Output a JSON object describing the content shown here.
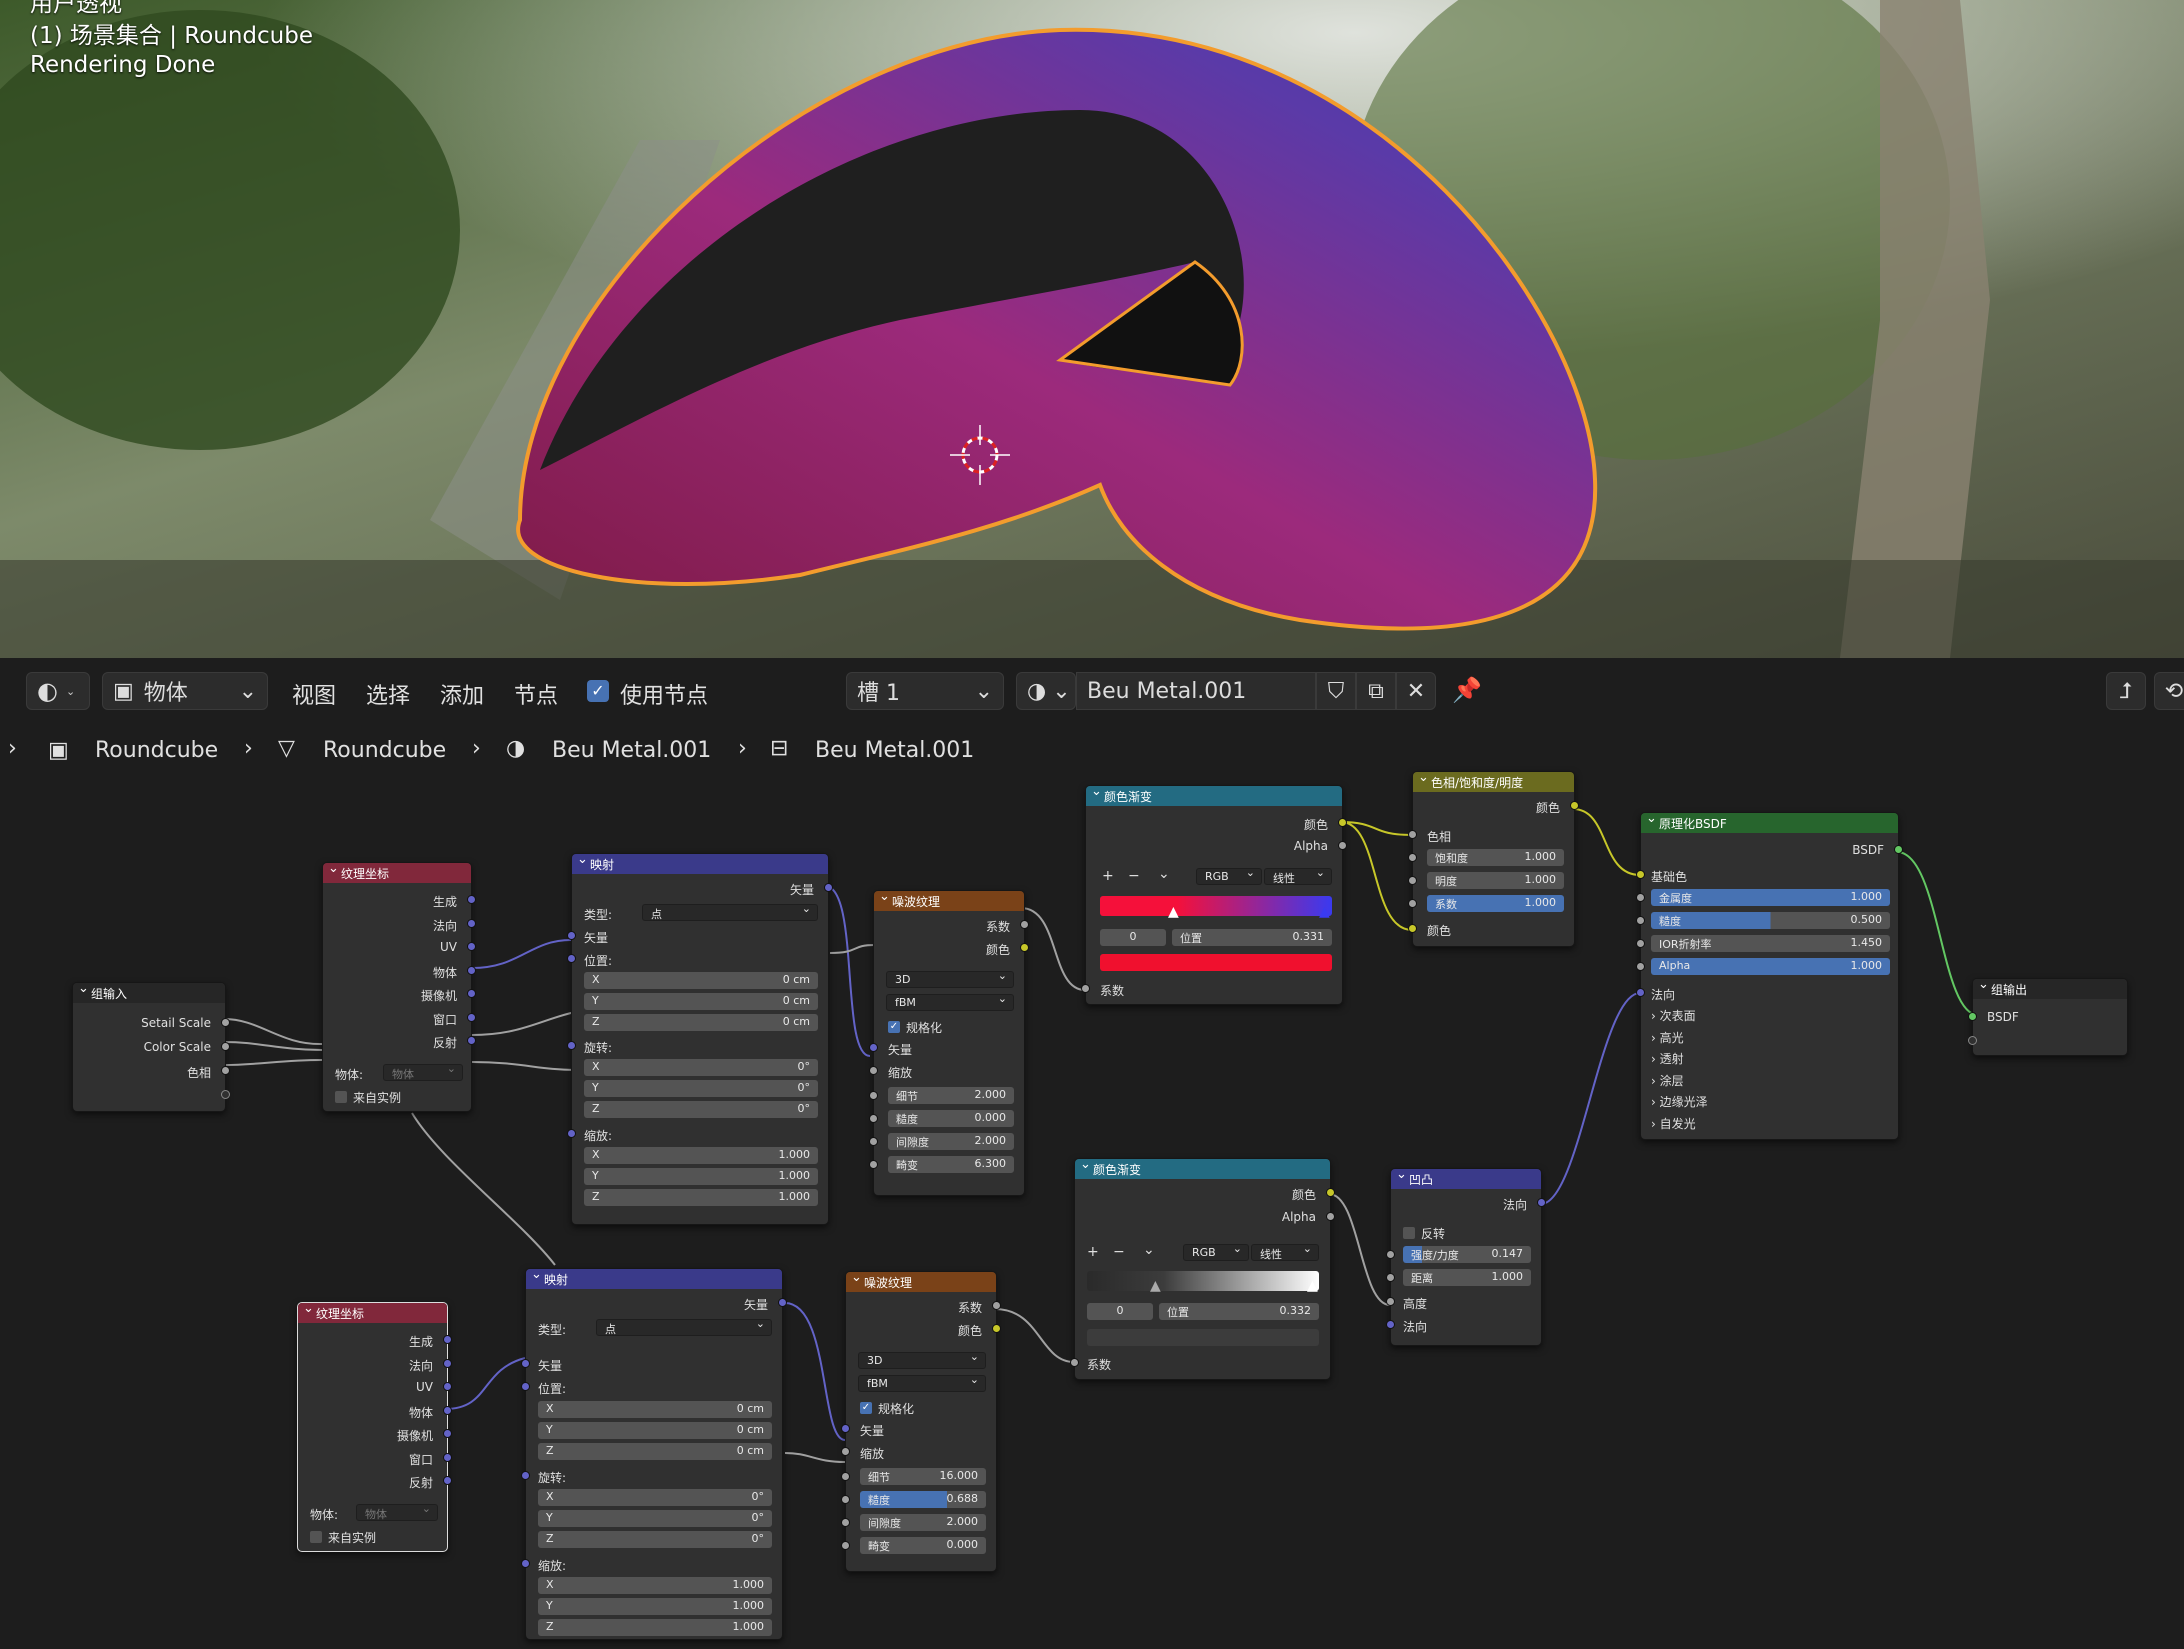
{
  "viewport": {
    "line0": "用户透视",
    "line1": "(1) 场景集合 | Roundcube",
    "line2": "Rendering Done",
    "object_outline_color": "#f39c2d"
  },
  "header": {
    "object_mode": "物体",
    "menus": [
      "视图",
      "选择",
      "添加",
      "节点"
    ],
    "use_nodes_label": "使用节点",
    "use_nodes_checked": true,
    "slot": "槽 1",
    "material_name": "Beu Metal.001"
  },
  "breadcrumb": [
    "Roundcube",
    "Roundcube",
    "Beu Metal.001",
    "Beu Metal.001"
  ],
  "nodes": {
    "group_input": {
      "title": "组输入",
      "outputs": [
        "Setail Scale",
        "Color Scale",
        "色相"
      ]
    },
    "texcoord1": {
      "title": "纹理坐标",
      "outputs": [
        "生成",
        "法向",
        "UV",
        "物体",
        "摄像机",
        "窗口",
        "反射"
      ],
      "object_label": "物体:",
      "object_placeholder": "物体",
      "instancer": "来自实例"
    },
    "mapping1": {
      "title": "映射",
      "out": "矢量",
      "type_label": "类型:",
      "type_value": "点",
      "vector": "矢量",
      "location": "位置:",
      "rotation": "旋转:",
      "scale": "缩放:",
      "loc": [
        [
          "X",
          "0 cm"
        ],
        [
          "Y",
          "0 cm"
        ],
        [
          "Z",
          "0 cm"
        ]
      ],
      "rot": [
        [
          "X",
          "0°"
        ],
        [
          "Y",
          "0°"
        ],
        [
          "Z",
          "0°"
        ]
      ],
      "scl": [
        [
          "X",
          "1.000"
        ],
        [
          "Y",
          "1.000"
        ],
        [
          "Z",
          "1.000"
        ]
      ]
    },
    "noise1": {
      "title": "噪波纹理",
      "out_fac": "系数",
      "out_color": "颜色",
      "dim": "3D",
      "type": "fBM",
      "normalize": "规格化",
      "vector": "矢量",
      "scale": "缩放",
      "detail": [
        "细节",
        "2.000"
      ],
      "roughness": [
        "糙度",
        "0.000"
      ],
      "lacunarity": [
        "间隙度",
        "2.000"
      ],
      "distortion": [
        "畸变",
        "6.300"
      ]
    },
    "ramp1": {
      "title": "颜色渐变",
      "out_color": "颜色",
      "out_alpha": "Alpha",
      "mode": "RGB",
      "interp": "线性",
      "index": "0",
      "pos_label": "位置",
      "pos_value": "0.331",
      "fac": "系数",
      "stop_color": "#f0102e",
      "ramp_start": "#f5103a",
      "ramp_end": "#3a3af0"
    },
    "hsv": {
      "title": "色相/饱和度/明度",
      "out": "颜色",
      "hue": "色相",
      "sat": [
        "饱和度",
        "1.000"
      ],
      "val": [
        "明度",
        "1.000"
      ],
      "fac": [
        "系数",
        "1.000"
      ],
      "color": "颜色"
    },
    "bsdf": {
      "title": "原理化BSDF",
      "out": "BSDF",
      "base": "基础色",
      "metallic": [
        "金属度",
        "1.000"
      ],
      "roughness": [
        "糙度",
        "0.500"
      ],
      "ior": [
        "IOR折射率",
        "1.450"
      ],
      "alpha": [
        "Alpha",
        "1.000"
      ],
      "normal": "法向",
      "panels": [
        "次表面",
        "高光",
        "透射",
        "涂层",
        "边缘光泽",
        "自发光"
      ]
    },
    "group_output": {
      "title": "组输出",
      "in": "BSDF"
    },
    "texcoord2": {
      "title": "纹理坐标",
      "outputs": [
        "生成",
        "法向",
        "UV",
        "物体",
        "摄像机",
        "窗口",
        "反射"
      ],
      "object_label": "物体:",
      "object_placeholder": "物体",
      "instancer": "来自实例"
    },
    "mapping2": {
      "title": "映射",
      "out": "矢量",
      "type_label": "类型:",
      "type_value": "点",
      "vector": "矢量",
      "location": "位置:",
      "rotation": "旋转:",
      "scale": "缩放:",
      "loc": [
        [
          "X",
          "0 cm"
        ],
        [
          "Y",
          "0 cm"
        ],
        [
          "Z",
          "0 cm"
        ]
      ],
      "rot": [
        [
          "X",
          "0°"
        ],
        [
          "Y",
          "0°"
        ],
        [
          "Z",
          "0°"
        ]
      ],
      "scl": [
        [
          "X",
          "1.000"
        ],
        [
          "Y",
          "1.000"
        ],
        [
          "Z",
          "1.000"
        ]
      ]
    },
    "noise2": {
      "title": "噪波纹理",
      "out_fac": "系数",
      "out_color": "颜色",
      "dim": "3D",
      "type": "fBM",
      "normalize": "规格化",
      "vector": "矢量",
      "scale": "缩放",
      "detail": [
        "细节",
        "16.000"
      ],
      "roughness": [
        "糙度",
        "0.688"
      ],
      "lacunarity": [
        "间隙度",
        "2.000"
      ],
      "distortion": [
        "畸变",
        "0.000"
      ]
    },
    "ramp2": {
      "title": "颜色渐变",
      "out_color": "颜色",
      "out_alpha": "Alpha",
      "mode": "RGB",
      "interp": "线性",
      "index": "0",
      "pos_label": "位置",
      "pos_value": "0.332",
      "fac": "系数",
      "stop_color": "#3c3c3c",
      "ramp_start": "#2a2a2a",
      "ramp_end": "#ffffff"
    },
    "bump": {
      "title": "凹凸",
      "out": "法向",
      "invert": "反转",
      "strength": [
        "强度/力度",
        "0.147"
      ],
      "distance": [
        "距离",
        "1.000"
      ],
      "height": "高度",
      "normal": "法向"
    }
  }
}
